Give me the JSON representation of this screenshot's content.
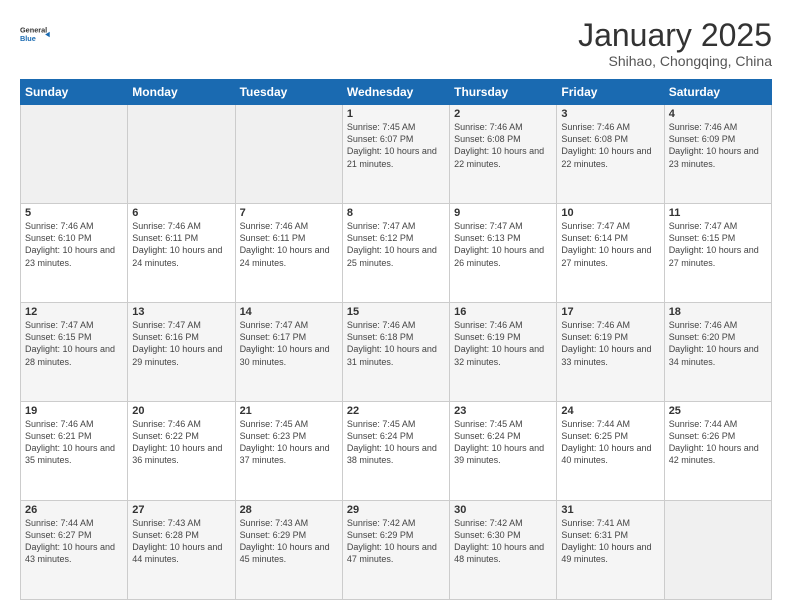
{
  "header": {
    "logo_line1": "General",
    "logo_line2": "Blue",
    "month": "January 2025",
    "location": "Shihao, Chongqing, China"
  },
  "days_of_week": [
    "Sunday",
    "Monday",
    "Tuesday",
    "Wednesday",
    "Thursday",
    "Friday",
    "Saturday"
  ],
  "weeks": [
    [
      {
        "day": "",
        "info": ""
      },
      {
        "day": "",
        "info": ""
      },
      {
        "day": "",
        "info": ""
      },
      {
        "day": "1",
        "info": "Sunrise: 7:45 AM\nSunset: 6:07 PM\nDaylight: 10 hours\nand 21 minutes."
      },
      {
        "day": "2",
        "info": "Sunrise: 7:46 AM\nSunset: 6:08 PM\nDaylight: 10 hours\nand 22 minutes."
      },
      {
        "day": "3",
        "info": "Sunrise: 7:46 AM\nSunset: 6:08 PM\nDaylight: 10 hours\nand 22 minutes."
      },
      {
        "day": "4",
        "info": "Sunrise: 7:46 AM\nSunset: 6:09 PM\nDaylight: 10 hours\nand 23 minutes."
      }
    ],
    [
      {
        "day": "5",
        "info": "Sunrise: 7:46 AM\nSunset: 6:10 PM\nDaylight: 10 hours\nand 23 minutes."
      },
      {
        "day": "6",
        "info": "Sunrise: 7:46 AM\nSunset: 6:11 PM\nDaylight: 10 hours\nand 24 minutes."
      },
      {
        "day": "7",
        "info": "Sunrise: 7:46 AM\nSunset: 6:11 PM\nDaylight: 10 hours\nand 24 minutes."
      },
      {
        "day": "8",
        "info": "Sunrise: 7:47 AM\nSunset: 6:12 PM\nDaylight: 10 hours\nand 25 minutes."
      },
      {
        "day": "9",
        "info": "Sunrise: 7:47 AM\nSunset: 6:13 PM\nDaylight: 10 hours\nand 26 minutes."
      },
      {
        "day": "10",
        "info": "Sunrise: 7:47 AM\nSunset: 6:14 PM\nDaylight: 10 hours\nand 27 minutes."
      },
      {
        "day": "11",
        "info": "Sunrise: 7:47 AM\nSunset: 6:15 PM\nDaylight: 10 hours\nand 27 minutes."
      }
    ],
    [
      {
        "day": "12",
        "info": "Sunrise: 7:47 AM\nSunset: 6:15 PM\nDaylight: 10 hours\nand 28 minutes."
      },
      {
        "day": "13",
        "info": "Sunrise: 7:47 AM\nSunset: 6:16 PM\nDaylight: 10 hours\nand 29 minutes."
      },
      {
        "day": "14",
        "info": "Sunrise: 7:47 AM\nSunset: 6:17 PM\nDaylight: 10 hours\nand 30 minutes."
      },
      {
        "day": "15",
        "info": "Sunrise: 7:46 AM\nSunset: 6:18 PM\nDaylight: 10 hours\nand 31 minutes."
      },
      {
        "day": "16",
        "info": "Sunrise: 7:46 AM\nSunset: 6:19 PM\nDaylight: 10 hours\nand 32 minutes."
      },
      {
        "day": "17",
        "info": "Sunrise: 7:46 AM\nSunset: 6:19 PM\nDaylight: 10 hours\nand 33 minutes."
      },
      {
        "day": "18",
        "info": "Sunrise: 7:46 AM\nSunset: 6:20 PM\nDaylight: 10 hours\nand 34 minutes."
      }
    ],
    [
      {
        "day": "19",
        "info": "Sunrise: 7:46 AM\nSunset: 6:21 PM\nDaylight: 10 hours\nand 35 minutes."
      },
      {
        "day": "20",
        "info": "Sunrise: 7:46 AM\nSunset: 6:22 PM\nDaylight: 10 hours\nand 36 minutes."
      },
      {
        "day": "21",
        "info": "Sunrise: 7:45 AM\nSunset: 6:23 PM\nDaylight: 10 hours\nand 37 minutes."
      },
      {
        "day": "22",
        "info": "Sunrise: 7:45 AM\nSunset: 6:24 PM\nDaylight: 10 hours\nand 38 minutes."
      },
      {
        "day": "23",
        "info": "Sunrise: 7:45 AM\nSunset: 6:24 PM\nDaylight: 10 hours\nand 39 minutes."
      },
      {
        "day": "24",
        "info": "Sunrise: 7:44 AM\nSunset: 6:25 PM\nDaylight: 10 hours\nand 40 minutes."
      },
      {
        "day": "25",
        "info": "Sunrise: 7:44 AM\nSunset: 6:26 PM\nDaylight: 10 hours\nand 42 minutes."
      }
    ],
    [
      {
        "day": "26",
        "info": "Sunrise: 7:44 AM\nSunset: 6:27 PM\nDaylight: 10 hours\nand 43 minutes."
      },
      {
        "day": "27",
        "info": "Sunrise: 7:43 AM\nSunset: 6:28 PM\nDaylight: 10 hours\nand 44 minutes."
      },
      {
        "day": "28",
        "info": "Sunrise: 7:43 AM\nSunset: 6:29 PM\nDaylight: 10 hours\nand 45 minutes."
      },
      {
        "day": "29",
        "info": "Sunrise: 7:42 AM\nSunset: 6:29 PM\nDaylight: 10 hours\nand 47 minutes."
      },
      {
        "day": "30",
        "info": "Sunrise: 7:42 AM\nSunset: 6:30 PM\nDaylight: 10 hours\nand 48 minutes."
      },
      {
        "day": "31",
        "info": "Sunrise: 7:41 AM\nSunset: 6:31 PM\nDaylight: 10 hours\nand 49 minutes."
      },
      {
        "day": "",
        "info": ""
      }
    ]
  ]
}
